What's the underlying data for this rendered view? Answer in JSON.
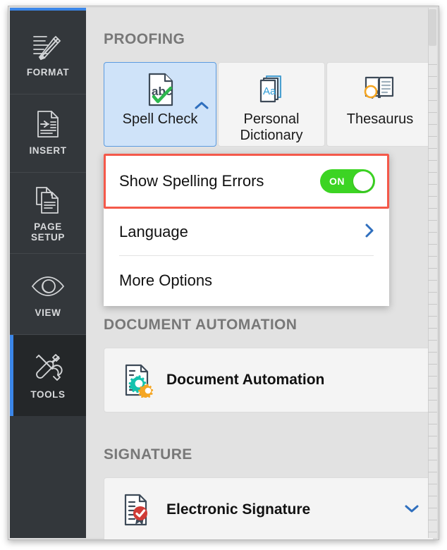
{
  "sidebar": {
    "accent_color": "#3b86e8",
    "background": "#33373b",
    "items": [
      {
        "id": "format",
        "label": "FORMAT",
        "icon": "pencil-underline-icon",
        "active": false
      },
      {
        "id": "insert",
        "label": "INSERT",
        "icon": "insert-document-icon",
        "active": false
      },
      {
        "id": "page-setup",
        "label": "PAGE\nSETUP",
        "label_line1": "PAGE",
        "label_line2": "SETUP",
        "icon": "pages-stack-icon",
        "active": false
      },
      {
        "id": "view",
        "label": "VIEW",
        "icon": "eye-icon",
        "active": false
      },
      {
        "id": "tools",
        "label": "TOOLS",
        "icon": "tools-wrench-screwdriver-icon",
        "active": true
      }
    ]
  },
  "panel": {
    "sections": [
      {
        "id": "proofing",
        "heading": "PROOFING"
      },
      {
        "id": "document-automation",
        "heading": "DOCUMENT AUTOMATION"
      },
      {
        "id": "signature",
        "heading": "SIGNATURE"
      }
    ],
    "proofing": {
      "tiles": [
        {
          "id": "spell-check",
          "label": "Spell Check",
          "icon": "document-abc-check-icon",
          "selected": true,
          "caret": "chevron-up-icon"
        },
        {
          "id": "personal-dictionary",
          "label_line1": "Personal",
          "label_line2": "Dictionary",
          "label": "Personal Dictionary",
          "icon": "dictionary-books-aa-icon",
          "selected": false
        },
        {
          "id": "thesaurus",
          "label": "Thesaurus",
          "icon": "open-book-magnifier-icon",
          "selected": false
        }
      ]
    },
    "spell_check_menu": {
      "highlighted_row": "show-spelling-errors",
      "highlight_color": "#f4594a",
      "rows": [
        {
          "id": "show-spelling-errors",
          "label": "Show Spelling Errors",
          "control": "toggle",
          "toggle_state": "ON",
          "toggle_color": "#3cd423"
        },
        {
          "id": "language",
          "label": "Language",
          "control": "chevron-right-icon"
        },
        {
          "id": "more-options",
          "label": "More Options",
          "control": "none"
        }
      ]
    },
    "document_automation": {
      "id": "document-automation-action",
      "label": "Document Automation",
      "icon": "document-gears-icon"
    },
    "signature": {
      "id": "electronic-signature-action",
      "label": "Electronic Signature",
      "icon": "document-seal-check-icon",
      "caret": "chevron-down-icon"
    }
  }
}
